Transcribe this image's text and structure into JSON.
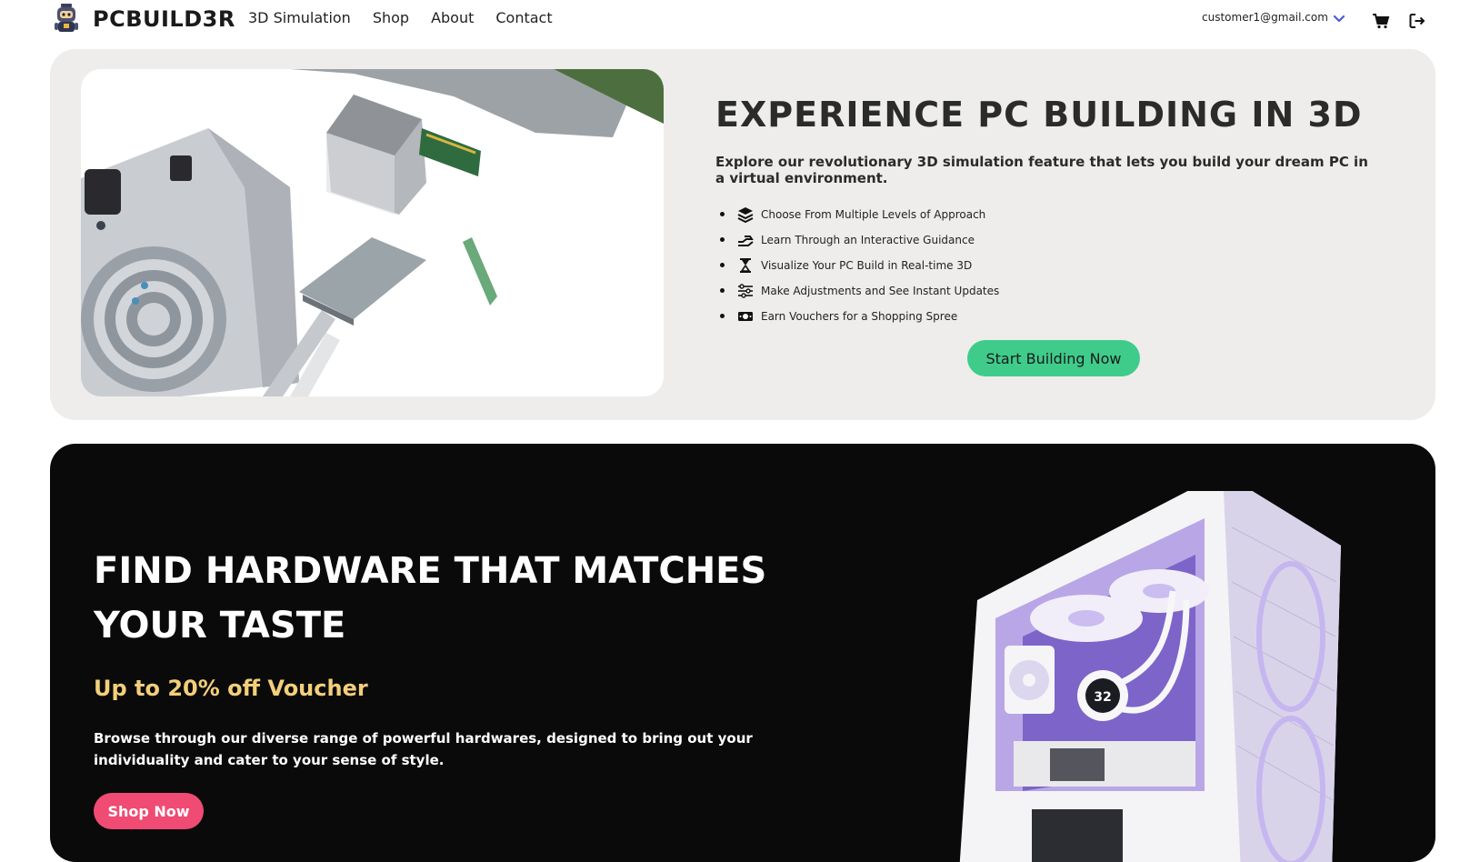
{
  "brand": {
    "name": "PCBUILD3R",
    "logo_icon": "robot-logo-icon"
  },
  "nav": {
    "links": [
      "3D Simulation",
      "Shop",
      "About",
      "Contact"
    ]
  },
  "user": {
    "email": "customer1@gmail.com"
  },
  "icons": {
    "dropdown": "chevron-down-icon",
    "cart": "cart-icon",
    "logout": "logout-icon"
  },
  "hero_3d": {
    "title": "EXPERIENCE PC BUILDING IN 3D",
    "description": "Explore our revolutionary 3D simulation feature that lets you build your dream PC in a virtual environment.",
    "features": [
      {
        "icon": "layers-icon",
        "label": "Choose From Multiple Levels of Approach"
      },
      {
        "icon": "hand-guide-icon",
        "label": "Learn Through an Interactive Guidance"
      },
      {
        "icon": "hourglass-icon",
        "label": "Visualize Your PC Build in Real-time 3D"
      },
      {
        "icon": "sliders-icon",
        "label": "Make Adjustments and See Instant Updates"
      },
      {
        "icon": "money-icon",
        "label": "Earn Vouchers for a Shopping Spree"
      }
    ],
    "cta": "Start Building Now"
  },
  "hero_shop": {
    "title": "FIND HARDWARE THAT MATCHES YOUR TASTE",
    "subtitle": "Up to 20% off Voucher",
    "description": "Browse through our diverse range of powerful hardwares, designed to bring out your individuality and cater to your sense of style.",
    "cta": "Shop Now",
    "case_display": "32"
  },
  "colors": {
    "accent_green": "#3fcc8b",
    "accent_pink": "#f04b73",
    "voucher_gold": "#f2cf7a",
    "hero_bg_light": "#eeedeb",
    "hero_bg_dark": "#0b0a0b",
    "chevron_blue": "#4a5bd6"
  }
}
